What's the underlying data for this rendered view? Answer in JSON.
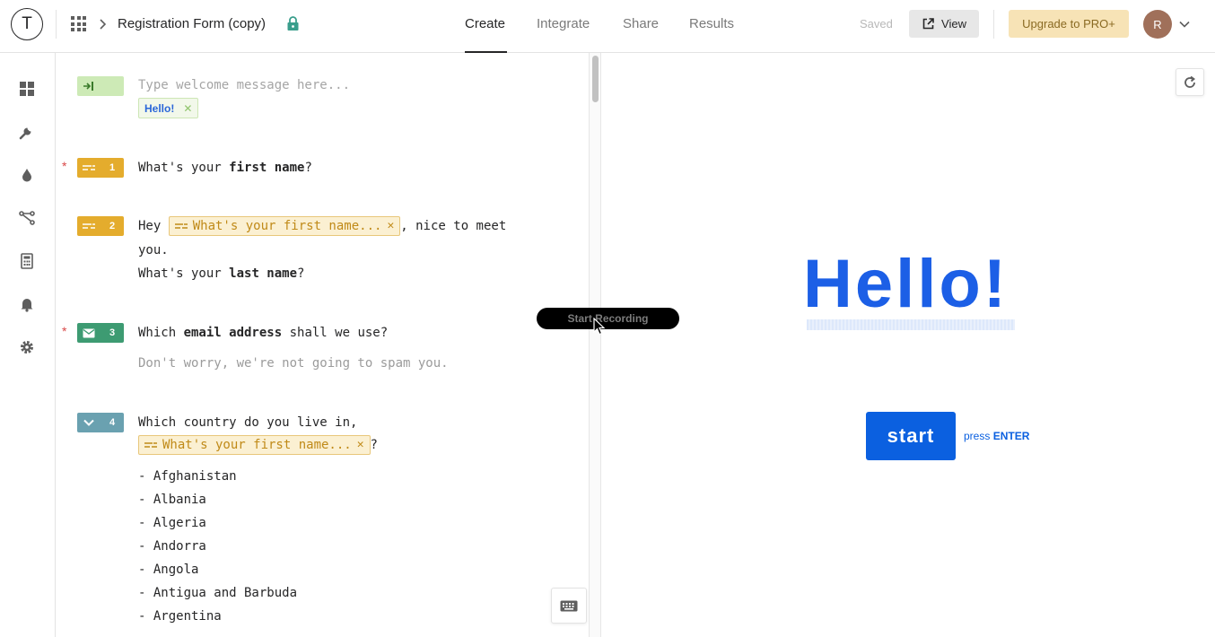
{
  "header": {
    "logo_letter": "T",
    "form_title": "Registration Form (copy)",
    "tabs": [
      {
        "label": "Create",
        "active": true
      },
      {
        "label": "Integrate",
        "active": false
      },
      {
        "label": "Share",
        "active": false
      },
      {
        "label": "Results",
        "active": false
      }
    ],
    "saved_label": "Saved",
    "view_label": "View",
    "upgrade_label": "Upgrade to PRO+",
    "avatar_initial": "R"
  },
  "rail": {
    "icons": [
      "dashboard-icon",
      "wrench-icon",
      "drop-icon",
      "logic-icon",
      "calculator-icon",
      "bell-icon",
      "gear-icon"
    ]
  },
  "editor": {
    "welcome": {
      "placeholder": "Type welcome message here...",
      "tag": "Hello!"
    },
    "questions": [
      {
        "number": "1",
        "required": true,
        "color": "#e4ac2d",
        "pre": "What's your ",
        "bold": "first name",
        "post": "?"
      },
      {
        "number": "2",
        "required": false,
        "color": "#e4ac2d",
        "pre": "Hey ",
        "recall": "What's your first name...",
        "post": ", nice to meet",
        "line2": "you.",
        "line3_pre": "What's your ",
        "line3_bold": "last name",
        "line3_post": "?"
      },
      {
        "number": "3",
        "required": true,
        "color": "#3d9b72",
        "pre": "Which ",
        "bold": "email address",
        "post": " shall we use?",
        "hint": "Don't worry, we're not going to spam you."
      },
      {
        "number": "4",
        "required": false,
        "color": "#6aa1b0",
        "pre": "Which country do you live in,",
        "recall": "What's your first name...",
        "post": "?",
        "options": [
          "- Afghanistan",
          "- Albania",
          "- Algeria",
          "- Andorra",
          "- Angola",
          "- Antigua and Barbuda",
          "- Argentina"
        ]
      }
    ]
  },
  "preview": {
    "hello": "Hello!",
    "start_label": "start",
    "press_label": "press",
    "enter_label": "ENTER"
  },
  "overlay": {
    "recording_label": "Start Recording"
  }
}
